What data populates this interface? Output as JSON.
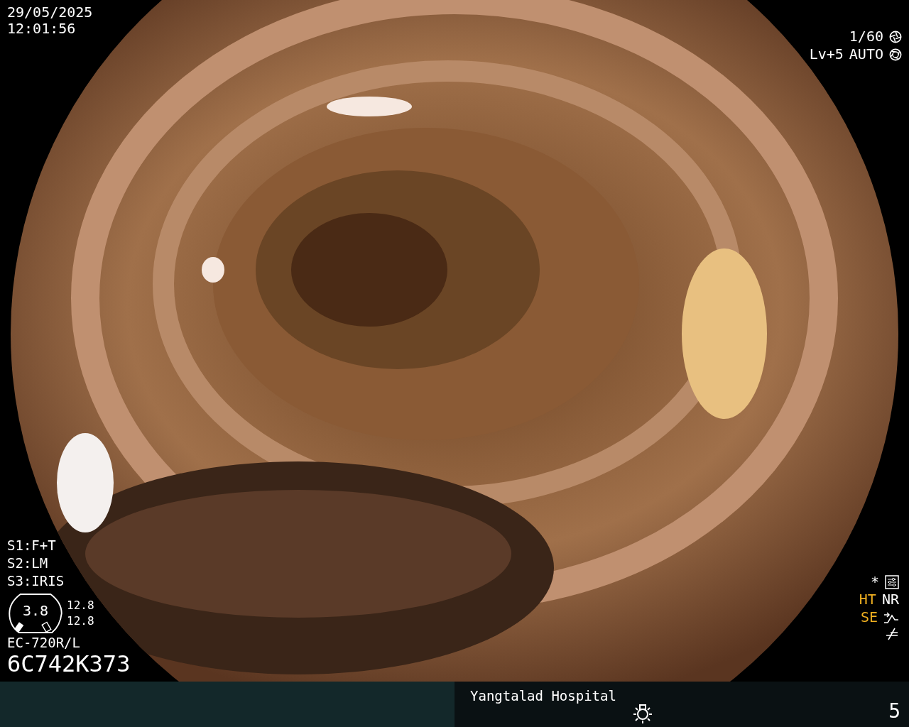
{
  "datetime": {
    "date": "29/05/2025",
    "time": "12:01:56"
  },
  "exposure": {
    "shutter": "1/60",
    "level": "Lv+5",
    "mode": "AUTO"
  },
  "switches": [
    {
      "label": "S1:",
      "value": "F+T"
    },
    {
      "label": "S2:",
      "value": "LM"
    },
    {
      "label": "S3:",
      "value": "IRIS"
    }
  ],
  "scope": {
    "channel": "3.8",
    "readings": [
      "12.8",
      "12.8"
    ],
    "model": "EC-720R/L",
    "serial": "6C742K373"
  },
  "enhance": {
    "mark": "*",
    "row": [
      {
        "label": "HT",
        "color": "#f0b020"
      },
      {
        "label": "NR",
        "color": "#ffffff"
      }
    ],
    "se": {
      "label": "SE",
      "color": "#f0b020"
    }
  },
  "footer": {
    "hospital": "Yangtalad Hospital",
    "light_level": "5"
  }
}
